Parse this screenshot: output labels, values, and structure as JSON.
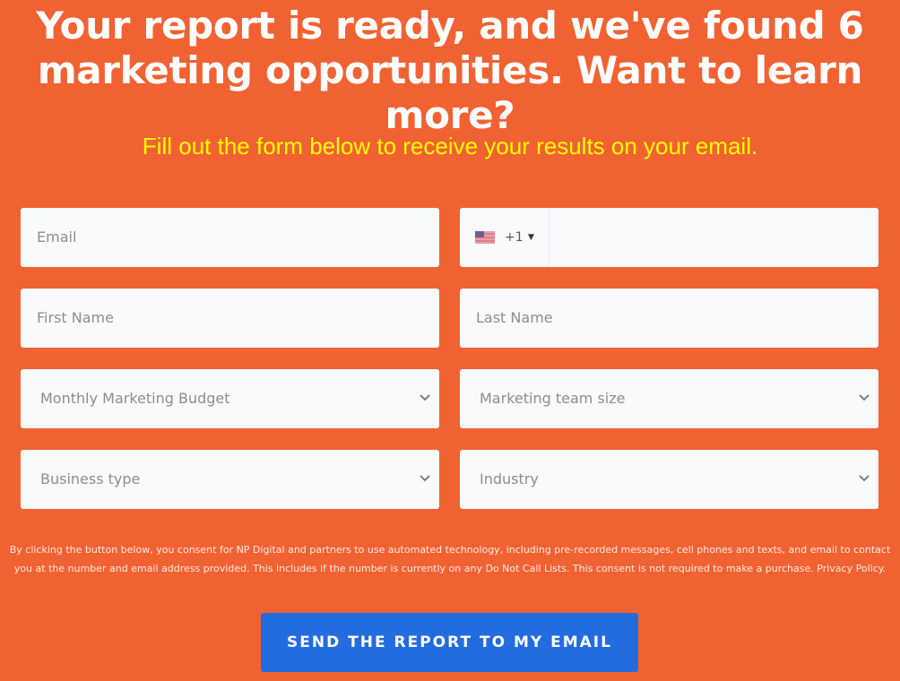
{
  "header": {
    "title_line1": "Your report is ready, and we've found 6",
    "title_line2": "marketing opportunities. Want to learn more?",
    "subtitle": "Fill out the form below to receive your results on your email."
  },
  "form": {
    "email": {
      "placeholder": "Email",
      "value": ""
    },
    "phone": {
      "country_icon": "us-flag-icon",
      "dial_code": "+1",
      "value": ""
    },
    "first_name": {
      "placeholder": "First Name",
      "value": ""
    },
    "last_name": {
      "placeholder": "Last Name",
      "value": ""
    },
    "budget": {
      "selected": "Monthly Marketing Budget"
    },
    "team_size": {
      "selected": "Marketing team size"
    },
    "business_type": {
      "selected": "Business type"
    },
    "industry": {
      "selected": "Industry"
    }
  },
  "consent": {
    "line1": "By clicking the button below, you consent for NP Digital and partners to use automated technology, including pre-recorded messages, cell phones and texts, and email to contact",
    "line2": "you at the number and email address provided. This includes if the number is currently on any Do Not Call Lists. This consent is not required to make a purchase.",
    "privacy_link": "Privacy Policy."
  },
  "submit_label": "SEND THE REPORT TO MY EMAIL",
  "colors": {
    "background": "#f16232",
    "subtitle": "#ffff00",
    "button": "#236ce0",
    "field": "#f9fafc"
  }
}
